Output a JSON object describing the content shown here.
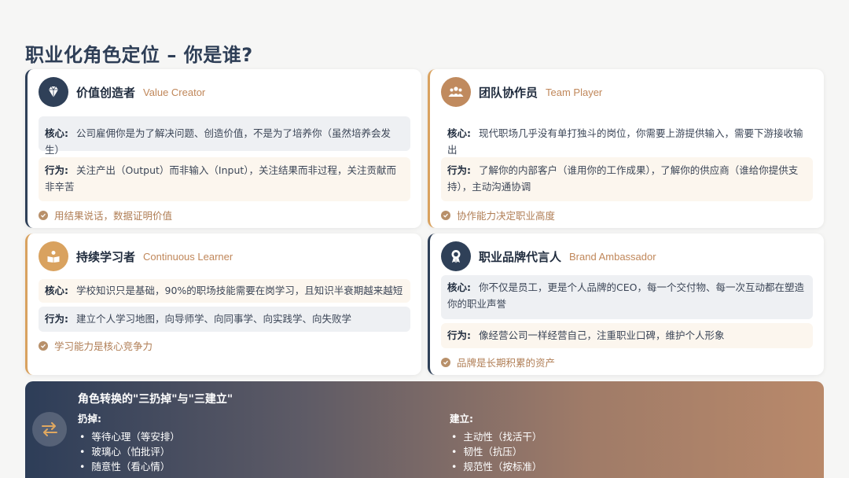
{
  "title": "职业化角色定位 – 你是谁?",
  "cards": [
    {
      "name": "价值创造者",
      "en": "Value Creator",
      "icon": "diamond-icon",
      "core_label": "核心:",
      "core_text": "公司雇佣你是为了解决问题、创造价值，不是为了培养你（虽然培养会发生）",
      "act_label": "行为:",
      "act_text": "关注产出（Output）而非输入（Input），关注结果而非过程，关注贡献而非辛苦",
      "foot": "用结果说话，数据证明价值"
    },
    {
      "name": "团队协作员",
      "en": "Team Player",
      "icon": "team-icon",
      "core_label": "核心:",
      "core_text": "现代职场几乎没有单打独斗的岗位，你需要上游提供输入，需要下游接收输出",
      "act_label": "行为:",
      "act_text": "了解你的内部客户（谁用你的工作成果），了解你的供应商（谁给你提供支持），主动沟通协调",
      "foot": "协作能力决定职业高度"
    },
    {
      "name": "持续学习者",
      "en": "Continuous Learner",
      "icon": "reader-icon",
      "core_label": "核心:",
      "core_text": "学校知识只是基础，90%的职场技能需要在岗学习，且知识半衰期越来越短",
      "act_label": "行为:",
      "act_text": "建立个人学习地图，向导师学、向同事学、向实践学、向失败学",
      "foot": "学习能力是核心竞争力"
    },
    {
      "name": "职业品牌代言人",
      "en": "Brand Ambassador",
      "icon": "award-icon",
      "core_label": "核心:",
      "core_text": "你不仅是员工，更是个人品牌的CEO，每一个交付物、每一次互动都在塑造你的职业声誉",
      "act_label": "行为:",
      "act_text": "像经营公司一样经营自己，注重职业口碑，维护个人形象",
      "foot": "品牌是长期积累的资产"
    }
  ],
  "banner": {
    "title": "角色转换的\"三扔掉\"与\"三建立\"",
    "left_heading": "扔掉:",
    "left_items": [
      "等待心理（等安排）",
      "玻璃心（怕批评）",
      "随意性（看心情）"
    ],
    "right_heading": "建立:",
    "right_items": [
      "主动性（找活干）",
      "韧性（抗压）",
      "规范性（按标准）"
    ],
    "icon": "swap-icon"
  },
  "colors": {
    "navy": "#2f4058",
    "tan": "#d9a25f",
    "brown": "#c08a5e",
    "accent_text": "#c0875a"
  }
}
